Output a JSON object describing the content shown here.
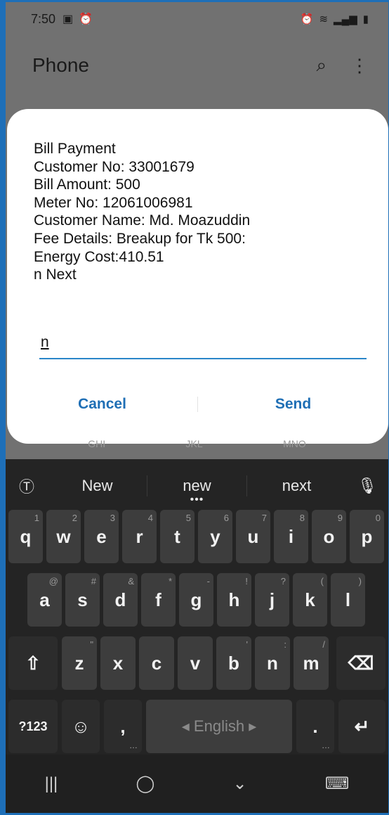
{
  "status_bar": {
    "time": "7:50",
    "left_icons": [
      "image-icon",
      "alarm-icon"
    ],
    "right_icons": [
      "alarm-icon",
      "wifi-icon",
      "signal-icon",
      "signal-icon",
      "battery-icon"
    ]
  },
  "app": {
    "title": "Phone",
    "actions": [
      "search-icon",
      "more-vert-icon"
    ]
  },
  "dialog": {
    "lines": [
      "Bill Payment",
      "Customer No: 33001679",
      "Bill Amount: 500",
      "Meter No: 12061006981",
      "Customer Name: Md. Moazuddin",
      "Fee Details: Breakup for Tk 500:",
      "Energy Cost:410.51",
      "n Next"
    ],
    "input_value": "n",
    "cancel_label": "Cancel",
    "send_label": "Send"
  },
  "keypad_hint": [
    "GHI",
    "JKL",
    "MNO"
  ],
  "keyboard": {
    "suggestions": [
      "New",
      "new",
      "next"
    ],
    "suggestion_more": "•••",
    "row1": [
      {
        "k": "q",
        "s": "1"
      },
      {
        "k": "w",
        "s": "2"
      },
      {
        "k": "e",
        "s": "3"
      },
      {
        "k": "r",
        "s": "4"
      },
      {
        "k": "t",
        "s": "5"
      },
      {
        "k": "y",
        "s": "6"
      },
      {
        "k": "u",
        "s": "7"
      },
      {
        "k": "i",
        "s": "8"
      },
      {
        "k": "o",
        "s": "9"
      },
      {
        "k": "p",
        "s": "0"
      }
    ],
    "row2": [
      {
        "k": "a",
        "s": "@"
      },
      {
        "k": "s",
        "s": "#"
      },
      {
        "k": "d",
        "s": "&"
      },
      {
        "k": "f",
        "s": "*"
      },
      {
        "k": "g",
        "s": "-"
      },
      {
        "k": "h",
        "s": "!"
      },
      {
        "k": "j",
        "s": "?"
      },
      {
        "k": "k",
        "s": "("
      },
      {
        "k": "l",
        "s": ")"
      }
    ],
    "row3": [
      {
        "k": "z",
        "s": "\""
      },
      {
        "k": "x",
        "s": ""
      },
      {
        "k": "c",
        "s": ""
      },
      {
        "k": "v",
        "s": ""
      },
      {
        "k": "b",
        "s": "'"
      },
      {
        "k": "n",
        "s": ":"
      },
      {
        "k": "m",
        "s": "/"
      }
    ],
    "symbols_label": "?123",
    "comma_label": ",",
    "space_label": "◂ English ▸",
    "period_label": ".",
    "shift_glyph": "⇧",
    "backspace_glyph": "⌫",
    "enter_glyph": "↵",
    "emoji_glyph": "☺"
  },
  "nav": {
    "recents_glyph": "|||",
    "home_glyph": "◯",
    "back_glyph": "⌄",
    "keyboard_glyph": "⌨"
  }
}
